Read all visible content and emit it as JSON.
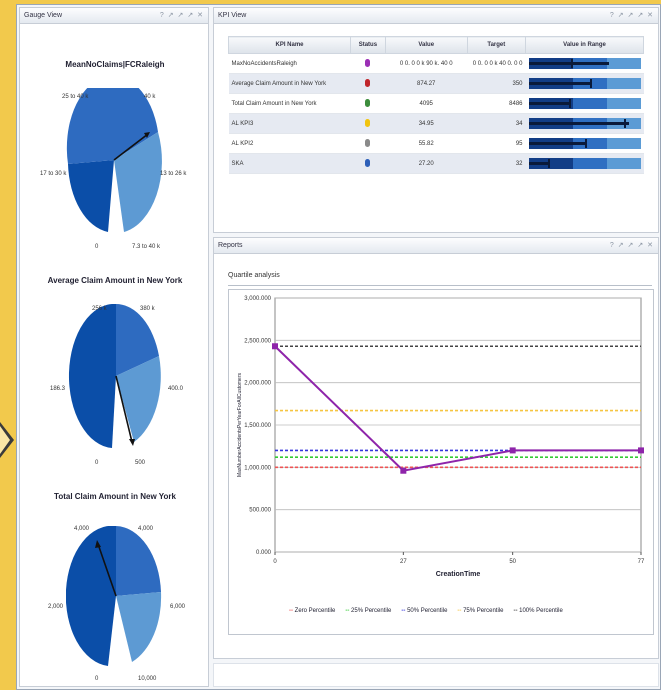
{
  "gauge_view": {
    "title": "Gauge View",
    "tools": "? ↗ ↗ ↗ ✕",
    "gauges": [
      {
        "title": "MeanNoClaims|FCRaleigh",
        "labels": [
          "25 to 40 k",
          "40 k",
          "17 to 30 k",
          "13 to 26 k",
          "0",
          "7.3 to 40 k"
        ]
      },
      {
        "title": "Average Claim Amount in New York",
        "labels": [
          "256 k",
          "380 k",
          "186.3",
          "400.0",
          "0",
          "500"
        ]
      },
      {
        "title": "Total Claim Amount in New York",
        "labels": [
          "4,000",
          "4,000",
          "2,000",
          "6,000",
          "0",
          "10,000"
        ]
      }
    ]
  },
  "kpi_view": {
    "title": "KPI View",
    "tools": "? ↗ ↗ ↗ ✕",
    "columns": [
      "KPI Name",
      "Status",
      "Value",
      "Target",
      "Value in Range"
    ],
    "rows": [
      {
        "name": "MaxNoAccidentsRaleigh",
        "status_color": "#9b2fb5",
        "value": "0 0. 0 0 k  90 k. 40 0",
        "target": "0 0. 0 0 k  40 0. 0 0",
        "fill": 0.72,
        "target_pos": 0.38
      },
      {
        "name": "Average Claim Amount in New York",
        "status_color": "#c0262b",
        "value": "874.27",
        "target": "350",
        "fill": 0.55,
        "target_pos": 0.55
      },
      {
        "name": "Total Claim Amount in New York",
        "status_color": "#3c8d3c",
        "value": "4095",
        "target": "8486",
        "fill": 0.36,
        "target_pos": 0.36
      },
      {
        "name": "AL KPI3",
        "status_color": "#f1c40f",
        "value": "34.95",
        "target": "34",
        "fill": 0.9,
        "target_pos": 0.85
      },
      {
        "name": "AL KPI2",
        "status_color": "#8a8a8a",
        "value": "55.82",
        "target": "95",
        "fill": 0.5,
        "target_pos": 0.5
      },
      {
        "name": "SKA",
        "status_color": "#2d5fb8",
        "value": "27.20",
        "target": "32",
        "fill": 0.18,
        "target_pos": 0.17
      }
    ]
  },
  "reports": {
    "title": "Reports",
    "tools": "? ↗ ↗ ↗ ✕",
    "chart_title": "Quartile analysis"
  },
  "chart_data": {
    "type": "line",
    "title": "Quartile analysis",
    "xlabel": "CreationTime",
    "ylabel": "MaxNumberAccidentsPerYearForAllCustomers",
    "x_ticks": [
      "0",
      "27",
      "50",
      "77"
    ],
    "y_ticks": [
      "3,000.000",
      "2,500.000",
      "2,000.000",
      "1,500.000",
      "1,000.000",
      "500.000",
      "0.000"
    ],
    "ylim": [
      0,
      3000
    ],
    "xlim": [
      0,
      77
    ],
    "series": [
      {
        "name": "MaxNumberAccidentsPerYearForAllCustomers",
        "color": "#8e24aa",
        "x": [
          0,
          27,
          50,
          77
        ],
        "y": [
          2430,
          960,
          1200,
          1200
        ]
      }
    ],
    "reference_lines": [
      {
        "name": "Zero Percentile",
        "color": "#e55",
        "value": 1000
      },
      {
        "name": "25% Percentile",
        "color": "#3c3",
        "value": 1120
      },
      {
        "name": "50% Percentile",
        "color": "#33d",
        "value": 1200
      },
      {
        "name": "75% Percentile",
        "color": "#f5c542",
        "value": 1670
      },
      {
        "name": "100% Percentile",
        "color": "#444",
        "value": 2430
      }
    ],
    "legend": [
      "Zero Percentile",
      "25% Percentile",
      "50% Percentile",
      "75% Percentile",
      "100% Percentile"
    ],
    "legend_position": "bottom",
    "grid": true
  }
}
